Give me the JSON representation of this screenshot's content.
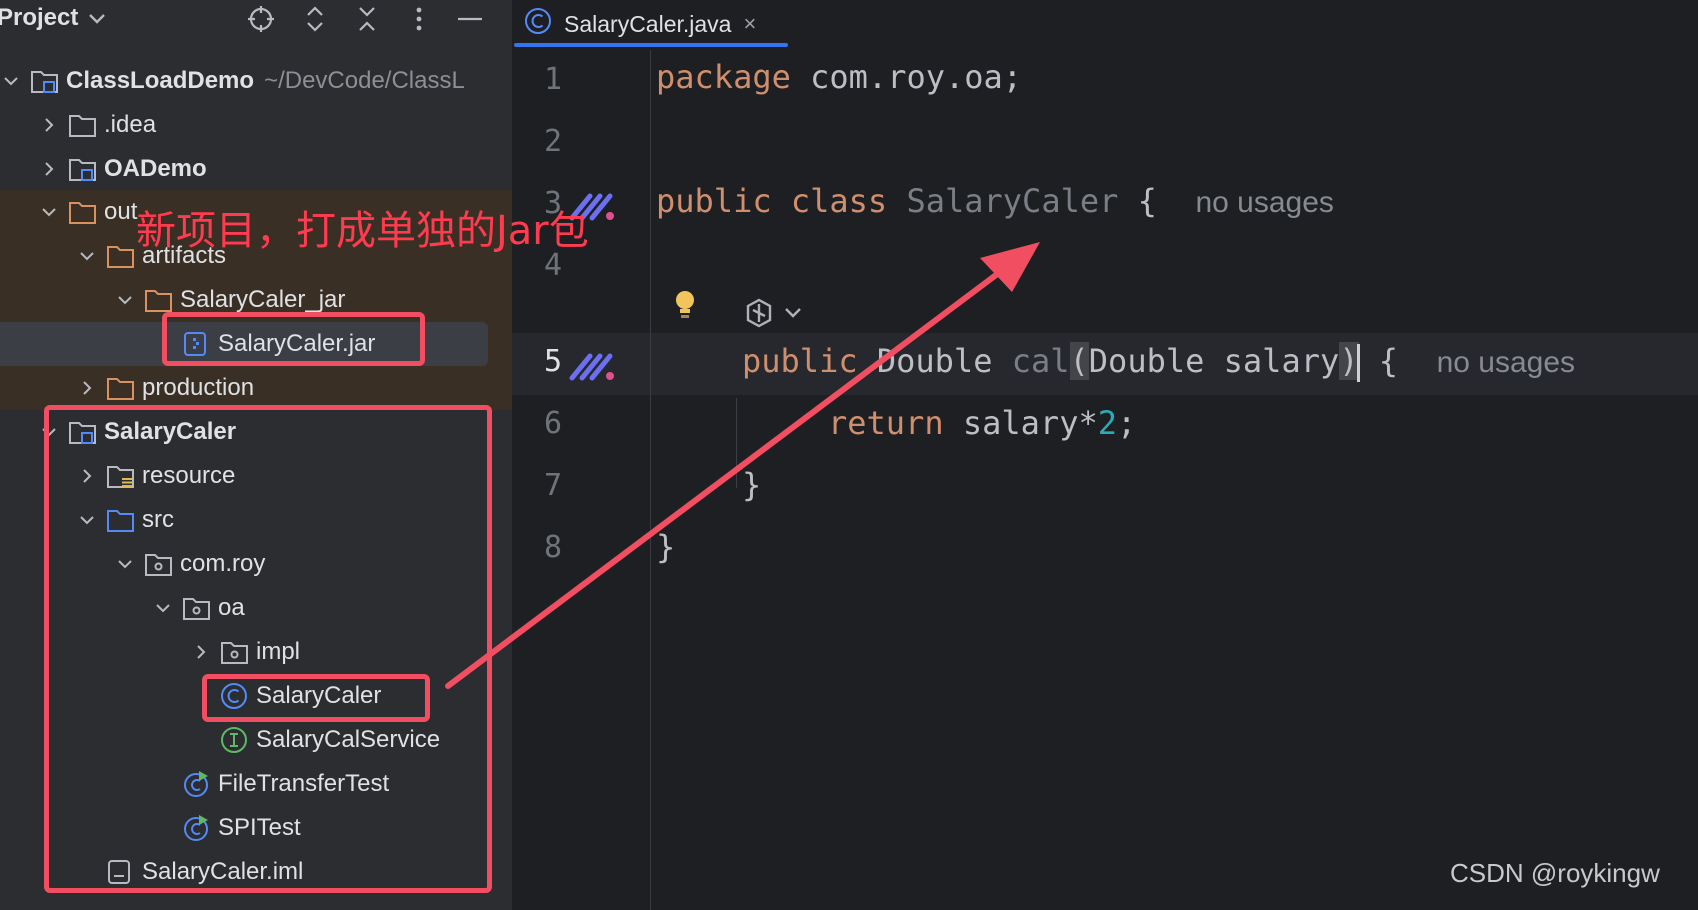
{
  "sidebar": {
    "title": "Project",
    "toolbar_icons": [
      "locate-icon",
      "expand-icon",
      "collapse-icon",
      "more-icon",
      "minimize-icon"
    ],
    "tree": [
      {
        "label": "ClassLoadDemo",
        "path": "~/DevCode/ClassL",
        "bold": true,
        "icon": "module-icon",
        "expanded": true
      },
      {
        "label": ".idea",
        "icon": "folder-icon",
        "expanded": false
      },
      {
        "label": "OADemo",
        "bold": true,
        "icon": "module-icon",
        "expanded": false
      },
      {
        "label": "out",
        "icon": "excluded-folder-icon",
        "expanded": true
      },
      {
        "label": "artifacts",
        "icon": "excluded-folder-icon",
        "expanded": true
      },
      {
        "label": "SalaryCaler_jar",
        "icon": "excluded-folder-icon",
        "expanded": true
      },
      {
        "label": "SalaryCaler.jar",
        "icon": "jar-icon",
        "selected": true
      },
      {
        "label": "production",
        "icon": "excluded-folder-icon",
        "expanded": false
      },
      {
        "label": "SalaryCaler",
        "bold": true,
        "icon": "module-icon",
        "expanded": true
      },
      {
        "label": "resource",
        "icon": "resource-folder-icon",
        "expanded": false
      },
      {
        "label": "src",
        "icon": "source-folder-icon",
        "expanded": true
      },
      {
        "label": "com.roy",
        "icon": "package-icon",
        "expanded": true
      },
      {
        "label": "oa",
        "icon": "package-icon",
        "expanded": true
      },
      {
        "label": "impl",
        "icon": "package-icon",
        "expanded": false
      },
      {
        "label": "SalaryCaler",
        "icon": "class-icon"
      },
      {
        "label": "SalaryCalService",
        "icon": "interface-icon"
      },
      {
        "label": "FileTransferTest",
        "icon": "runnable-class-icon"
      },
      {
        "label": "SPITest",
        "icon": "runnable-class-icon"
      },
      {
        "label": "SalaryCaler.iml",
        "icon": "iml-file-icon"
      }
    ]
  },
  "editor": {
    "tab_label": "SalaryCaler.java",
    "tab_close": "×",
    "line_numbers": [
      "1",
      "2",
      "3",
      "4",
      "5",
      "6",
      "7",
      "8"
    ],
    "code": {
      "l1_kw": "package",
      "l1_rest": " com.roy.oa;",
      "l3_kw1": "public",
      "l3_kw2": "class",
      "l3_name": "SalaryCaler",
      "l3_brace": " {",
      "l3_hint": "no usages",
      "l5_kw": "public",
      "l5_type": "Double",
      "l5_fn": "cal",
      "l5_lparen": "(",
      "l5_params": "Double salary",
      "l5_rparen": ")",
      "l5_brace": " {",
      "l5_hint": "no usages",
      "l6_kw": "return",
      "l6_expr": " salary*",
      "l6_num": "2",
      "l6_semi": ";",
      "l7": "}",
      "l8": "}"
    }
  },
  "annotation": {
    "text": "新项目，打成单独的Jar包",
    "color": "#f24e62"
  },
  "watermark": "CSDN @roykingw",
  "colors": {
    "sidebar_bg": "#2b2d30",
    "editor_bg": "#1e1f22",
    "keyword": "#cf8e6d",
    "accent": "#3574f0"
  }
}
